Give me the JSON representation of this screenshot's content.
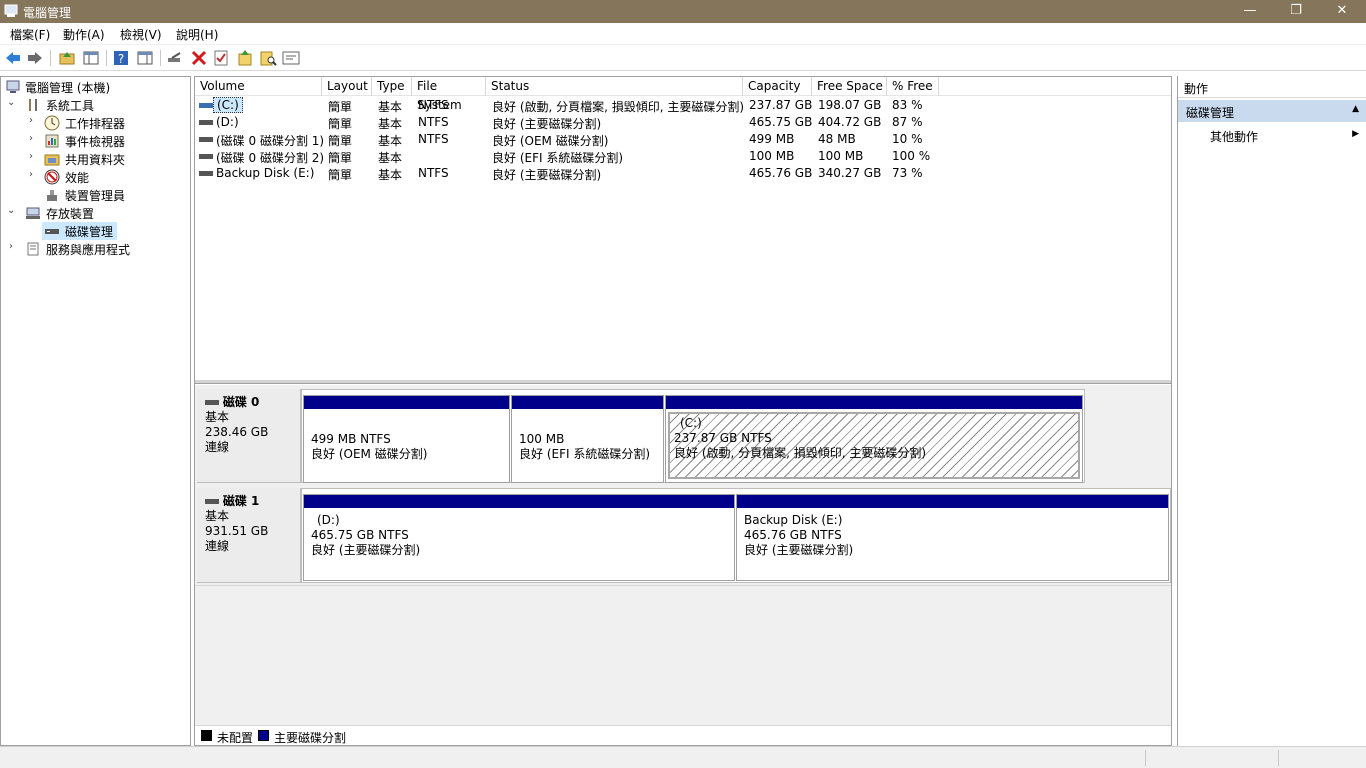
{
  "window": {
    "title": "電腦管理",
    "minimize": "—",
    "restore": "❐",
    "close": "✕"
  },
  "menu": [
    "檔案(F)",
    "動作(A)",
    "檢視(V)",
    "說明(H)"
  ],
  "toolbar": {
    "icons": [
      "back-icon",
      "forward-icon",
      "up-folder-icon",
      "show-hide-tree-icon",
      "help-icon",
      "show-hide-action-icon",
      "connect-icon",
      "delete-icon",
      "properties-icon",
      "refresh-icon",
      "search-icon",
      "export-icon"
    ]
  },
  "tree": [
    {
      "label": "電腦管理 (本機)",
      "chev": "",
      "icon": "computer-management-icon",
      "indent": 0
    },
    {
      "label": "系統工具",
      "chev": "⌄",
      "icon": "system-tools-icon",
      "indent": 1
    },
    {
      "label": "工作排程器",
      "chev": "›",
      "icon": "task-scheduler-icon",
      "indent": 2
    },
    {
      "label": "事件檢視器",
      "chev": "›",
      "icon": "event-viewer-icon",
      "indent": 2
    },
    {
      "label": "共用資料夾",
      "chev": "›",
      "icon": "shared-folders-icon",
      "indent": 2
    },
    {
      "label": "效能",
      "chev": "›",
      "icon": "performance-icon",
      "indent": 2
    },
    {
      "label": "裝置管理員",
      "chev": "",
      "icon": "device-manager-icon",
      "indent": 2
    },
    {
      "label": "存放裝置",
      "chev": "⌄",
      "icon": "storage-icon",
      "indent": 1
    },
    {
      "label": "磁碟管理",
      "chev": "",
      "icon": "disk-management-icon",
      "indent": 2,
      "selected": true
    },
    {
      "label": "服務與應用程式",
      "chev": "›",
      "icon": "services-icon",
      "indent": 1
    }
  ],
  "volumes": {
    "headers": [
      "Volume",
      "Layout",
      "Type",
      "File System",
      "Status",
      "Capacity",
      "Free Space",
      "% Free"
    ],
    "rows": [
      {
        "volume": "(C:)",
        "layout": "簡單",
        "type": "基本",
        "fs": "NTFS",
        "status": "良好 (啟動, 分頁檔案, 損毀傾印, 主要磁碟分割)",
        "capacity": "237.87 GB",
        "free": "198.07 GB",
        "pct": "83 %",
        "selected": true
      },
      {
        "volume": "(D:)",
        "layout": "簡單",
        "type": "基本",
        "fs": "NTFS",
        "status": "良好 (主要磁碟分割)",
        "capacity": "465.75 GB",
        "free": "404.72 GB",
        "pct": "87 %"
      },
      {
        "volume": "(磁碟 0 磁碟分割 1)",
        "layout": "簡單",
        "type": "基本",
        "fs": "NTFS",
        "status": "良好 (OEM 磁碟分割)",
        "capacity": "499 MB",
        "free": "48 MB",
        "pct": "10 %"
      },
      {
        "volume": "(磁碟 0 磁碟分割 2)",
        "layout": "簡單",
        "type": "基本",
        "fs": "",
        "status": "良好 (EFI 系統磁碟分割)",
        "capacity": "100 MB",
        "free": "100 MB",
        "pct": "100 %"
      },
      {
        "volume": "Backup Disk (E:)",
        "layout": "簡單",
        "type": "基本",
        "fs": "NTFS",
        "status": "良好 (主要磁碟分割)",
        "capacity": "465.76 GB",
        "free": "340.27 GB",
        "pct": "73 %"
      }
    ]
  },
  "disks": [
    {
      "name": "磁碟 0",
      "type": "基本",
      "size": "238.46 GB",
      "state": "連線",
      "partitions": [
        {
          "title": "",
          "size": "499 MB NTFS",
          "status": "良好 (OEM 磁碟分割)"
        },
        {
          "title": "",
          "size": "100 MB",
          "status": "良好 (EFI 系統磁碟分割)"
        },
        {
          "title": "(C:)",
          "size": "237.87 GB NTFS",
          "status": "良好 (啟動, 分頁檔案, 損毀傾印, 主要磁碟分割)"
        }
      ]
    },
    {
      "name": "磁碟 1",
      "type": "基本",
      "size": "931.51 GB",
      "state": "連線",
      "partitions": [
        {
          "title": "(D:)",
          "size": "465.75 GB NTFS",
          "status": "良好 (主要磁碟分割)"
        },
        {
          "title": "Backup Disk  (E:)",
          "size": "465.76 GB NTFS",
          "status": "良好 (主要磁碟分割)"
        }
      ]
    }
  ],
  "legend": [
    {
      "label": "未配置",
      "color": "#000000"
    },
    {
      "label": "主要磁碟分割",
      "color": "#00008b"
    }
  ],
  "actions": {
    "header": "動作",
    "section": "磁碟管理",
    "section_arrow": "▲",
    "item": "其他動作",
    "item_arrow": "▶"
  },
  "colors": {
    "titlebar": "#84755b",
    "partition_bar": "#00008b",
    "selection": "#cce8ff"
  }
}
